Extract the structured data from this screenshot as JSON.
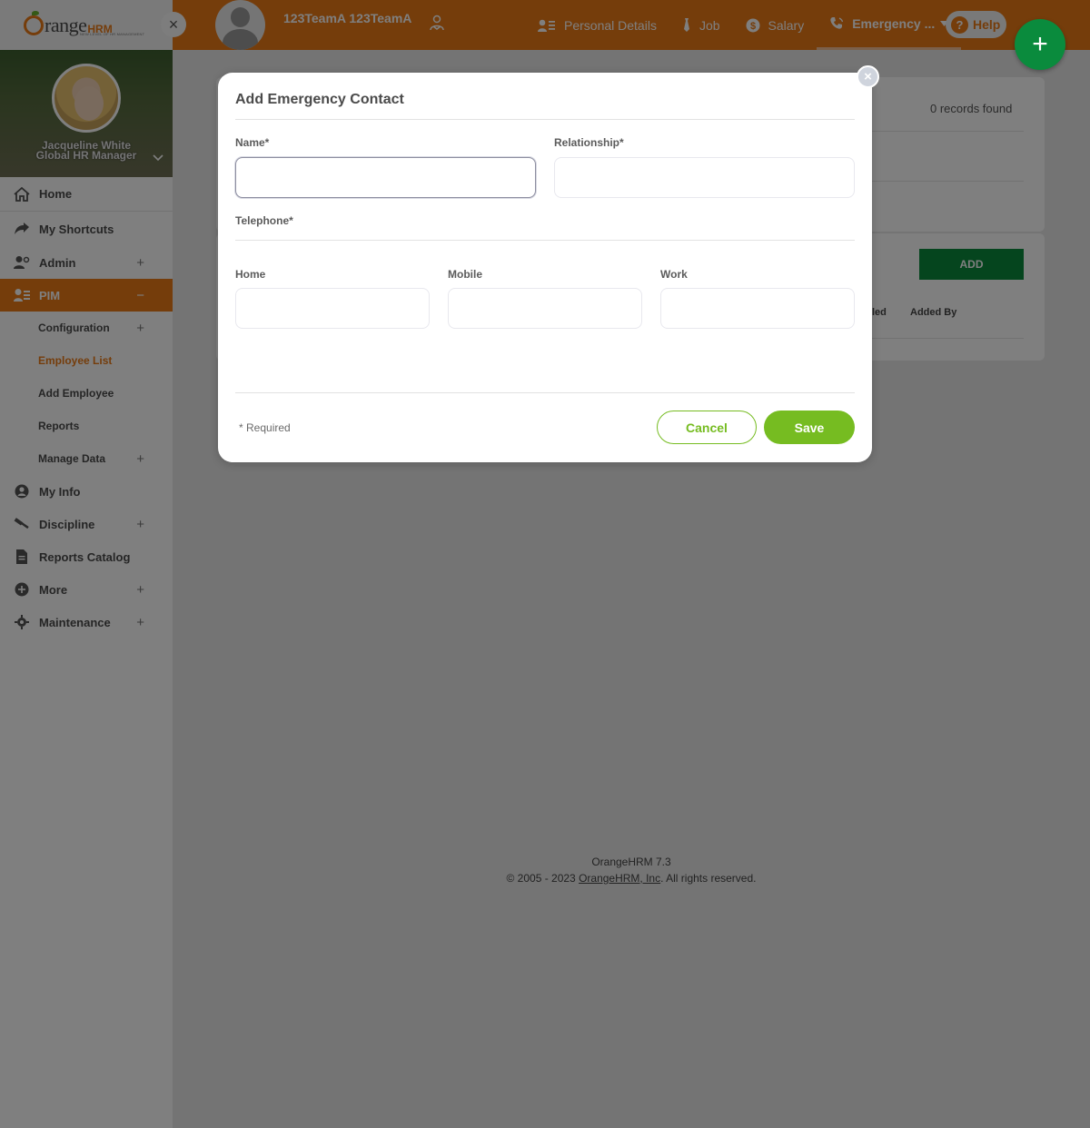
{
  "sidebar": {
    "logo": {
      "main": "range",
      "suffix": "HRM",
      "tagline": "NEW LEVEL OF HR MANAGEMENT"
    },
    "close_icon": "×",
    "profile": {
      "name": "Jacqueline White",
      "role": "Global HR Manager",
      "chevron": "⌄"
    },
    "menu": {
      "home": "Home",
      "shortcuts": "My Shortcuts",
      "admin": "Admin",
      "pim": "PIM",
      "pim_sub": {
        "configuration": "Configuration",
        "employee_list": "Employee List",
        "add_employee": "Add Employee",
        "reports": "Reports",
        "manage_data": "Manage Data"
      },
      "my_info": "My Info",
      "discipline": "Discipline",
      "reports_catalog": "Reports Catalog",
      "more": "More",
      "maintenance": "Maintenance"
    },
    "plus": "+",
    "minus": "−"
  },
  "topbar": {
    "employee_name": "123TeamA 123TeamA",
    "tabs": {
      "personal": "Personal Details",
      "job": "Job",
      "salary": "Salary",
      "emergency": "Emergency ..."
    },
    "help": "Help",
    "help_q": "?"
  },
  "fab": {
    "icon": "+"
  },
  "background": {
    "records_found": "0 records found",
    "add_button": "ADD",
    "col_partial": "led",
    "col_added_by": "Added By"
  },
  "footer": {
    "version": "OrangeHRM 7.3",
    "copyright_prefix": "© 2005 - 2023 ",
    "company_link": "OrangeHRM, Inc",
    "copyright_suffix": ". All rights reserved."
  },
  "modal": {
    "title": "Add Emergency Contact",
    "close": "×",
    "name_label": "Name*",
    "name_value": "",
    "relationship_label": "Relationship*",
    "relationship_value": "",
    "telephone_label": "Telephone*",
    "home_label": "Home",
    "home_value": "",
    "mobile_label": "Mobile",
    "mobile_value": "",
    "work_label": "Work",
    "work_value": "",
    "required_note": "* Required",
    "cancel": "Cancel",
    "save": "Save"
  },
  "colors": {
    "brand_orange": "#ea7a17",
    "accent_green": "#76bc21",
    "dark_green": "#0a8b3d"
  }
}
